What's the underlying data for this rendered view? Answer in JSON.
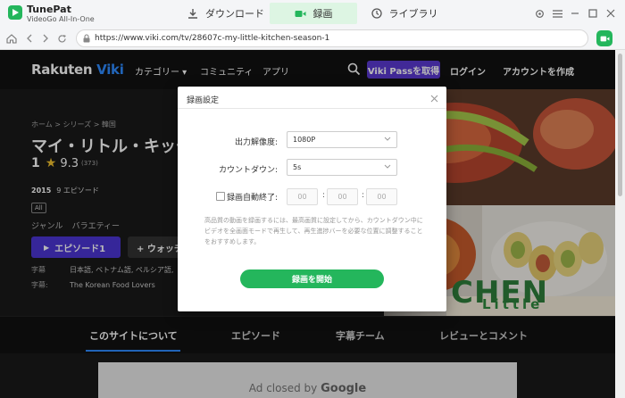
{
  "app": {
    "name": "TunePat",
    "subtitle": "VideoGo All-In-One",
    "tabs": [
      {
        "label": "ダウンロード",
        "icon": "download-icon"
      },
      {
        "label": "録画",
        "icon": "camera-icon",
        "active": true
      },
      {
        "label": "ライブラリ",
        "icon": "clock-icon"
      }
    ],
    "accent": "#24b65c"
  },
  "browser": {
    "url": "https://www.viki.com/tv/28607c-my-little-kitchen-season-1"
  },
  "viki": {
    "logo_a": "Rakuten ",
    "logo_b": "Viki",
    "nav": [
      "カテゴリー ▾",
      "コミュニティ",
      "アプリ"
    ],
    "pass_button": "Viki Passを取得",
    "login": "ログイン",
    "create_account": "アカウントを作成",
    "breadcrumb": "ホーム  >  シリーズ  >  韓国",
    "title": "マイ・リトル・キッチ",
    "rating_rank": "1",
    "rating_score": "9.3",
    "rating_count": "(373)",
    "year": "2015",
    "episodes": "9 エピソード",
    "age_badge": "All",
    "genre_key": "ジャンル",
    "genre_value": "バラエティー",
    "episode_button": "エピソード1",
    "watch_button": "+ ウォッチ",
    "subtitles_key": "字幕",
    "subtitles_value": "日本語, ベトナム語, ペルシア語,",
    "subteam_key": "字幕:",
    "subteam_value": "The Korean Food Lovers",
    "hero_text": "Little",
    "hero_text2": "CHEN",
    "section_tabs": [
      "このサイトについて",
      "エピソード",
      "字幕チーム",
      "レビューとコメント"
    ],
    "ad_text": "Ad closed by ",
    "ad_brand": "Google",
    "brand_color": "#2e8bff",
    "pass_color": "#5b3ad1"
  },
  "dialog": {
    "title": "録画設定",
    "resolution_label": "出力解像度:",
    "resolution_value": "1080P",
    "countdown_label": "カウントダウン:",
    "countdown_value": "5s",
    "autostop_label": "録画自動終了:",
    "time_h": "00",
    "time_m": "00",
    "time_s": "00",
    "note": "高品質の動画を録画するには、最高画質に設定してから、カウントダウン中にビデオを全画面モードで再生して、再生進捗バーを必要な位置に調整することをおすすめします。",
    "start_button": "録画を開始"
  }
}
